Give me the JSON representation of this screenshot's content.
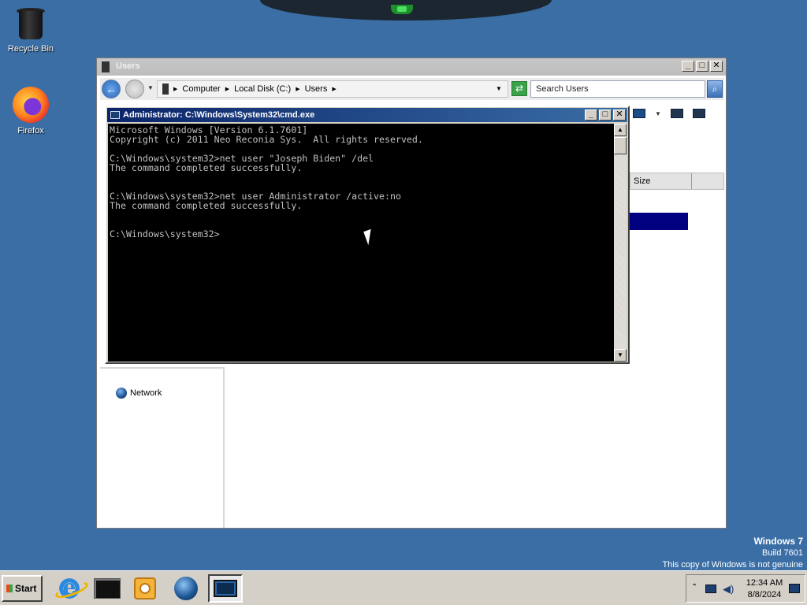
{
  "desktop": {
    "icons": [
      {
        "label": "Recycle Bin"
      },
      {
        "label": "Firefox"
      }
    ],
    "watermark": {
      "title": "Windows 7",
      "build": "Build 7601",
      "notice": "This copy of Windows is not genuine"
    }
  },
  "explorer": {
    "title": "Users",
    "address": {
      "crumbs": [
        "Computer",
        "Local Disk (C:)",
        "Users"
      ]
    },
    "search_placeholder": "Search Users",
    "column_header": "Size",
    "nav_items": [
      {
        "label": "Network"
      }
    ]
  },
  "cmd": {
    "title": "Administrator: C:\\Windows\\System32\\cmd.exe",
    "output": "Microsoft Windows [Version 6.1.7601]\nCopyright (c) 2011 Neo Reconia Sys.  All rights reserved.\n\nC:\\Windows\\system32>net user \"Joseph Biden\" /del\nThe command completed successfully.\n\n\nC:\\Windows\\system32>net user Administrator /active:no\nThe command completed successfully.\n\n\nC:\\Windows\\system32>"
  },
  "window_buttons": {
    "minimize": "_",
    "maximize": "□",
    "close": "✕"
  },
  "taskbar": {
    "start_label": "Start",
    "apps": [
      "internet-explorer-icon",
      "terminal-icon",
      "media-player-icon",
      "globe-icon",
      "cmd-icon"
    ],
    "clock": {
      "time": "12:34 AM",
      "date": "8/8/2024"
    }
  }
}
